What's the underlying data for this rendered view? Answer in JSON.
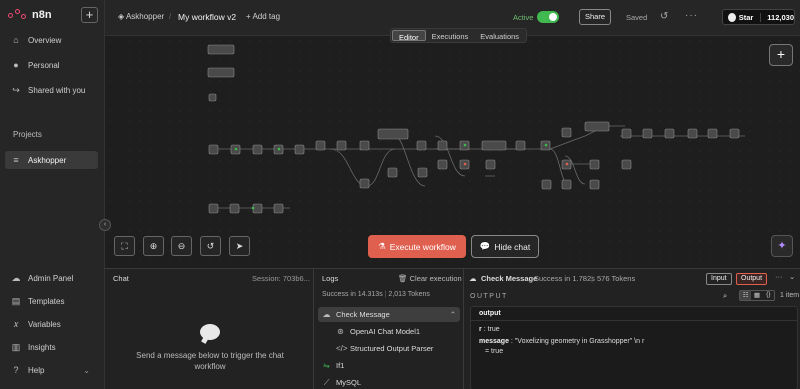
{
  "app": {
    "logo_text": "n8n"
  },
  "sidebar": {
    "new_label": "+",
    "items": [
      {
        "label": "Overview",
        "icon": "home-icon"
      },
      {
        "label": "Personal",
        "icon": "user-icon"
      },
      {
        "label": "Shared with you",
        "icon": "share-icon"
      }
    ],
    "projects_label": "Projects",
    "project_item": {
      "label": "Askhopper",
      "icon": "layers-icon"
    },
    "bottom_items": [
      {
        "label": "Admin Panel",
        "icon": "cloud-icon"
      },
      {
        "label": "Templates",
        "icon": "template-icon"
      },
      {
        "label": "Variables",
        "icon": "variables-icon"
      },
      {
        "label": "Insights",
        "icon": "chart-icon"
      },
      {
        "label": "Help",
        "icon": "help-icon"
      }
    ]
  },
  "header": {
    "project": "Askhopper",
    "workflow_name": "My workflow v2",
    "add_tag": "+ Add tag",
    "active_label": "Active",
    "share_label": "Share",
    "saved_label": "Saved",
    "star_label": "Star",
    "star_count": "112,030"
  },
  "canvas": {
    "tabs": [
      {
        "label": "Editor",
        "selected": true
      },
      {
        "label": "Executions",
        "selected": false
      },
      {
        "label": "Evaluations",
        "selected": false
      }
    ],
    "execute_label": "Execute workflow",
    "hide_chat_label": "Hide chat"
  },
  "chat": {
    "title": "Chat",
    "session": "Session: 703b6...",
    "empty_message": "Send a message below to trigger the chat workflow"
  },
  "logs": {
    "title": "Logs",
    "clear_label": "Clear execution",
    "status": "Success in 14.313s",
    "tokens": "2,013 Tokens",
    "rows": [
      {
        "label": "Check Message",
        "icon": "robot-icon",
        "selected": true
      },
      {
        "label": "OpenAI Chat Model1",
        "icon": "openai-icon",
        "selected": false
      },
      {
        "label": "Structured Output Parser",
        "icon": "code-icon",
        "selected": false
      },
      {
        "label": "If1",
        "icon": "if-icon",
        "selected": false
      },
      {
        "label": "MySQL",
        "icon": "mysql-icon",
        "selected": false
      }
    ]
  },
  "output": {
    "node_name": "Check Message",
    "status": "Success in 1.782s",
    "tokens": "576 Tokens",
    "input_label": "Input",
    "output_label": "Output",
    "section_label": "OUTPUT",
    "items_count": "1 item",
    "json_root": "output",
    "r_key": "r",
    "r_value": ": true",
    "message_key": "message",
    "message_value": ": \"Voxelizing geometry in Grasshopper\" \\n r",
    "message_tail": "= true"
  },
  "colors": {
    "accent": "#ea4b71",
    "execute": "#e06050",
    "active": "#3fb950"
  }
}
